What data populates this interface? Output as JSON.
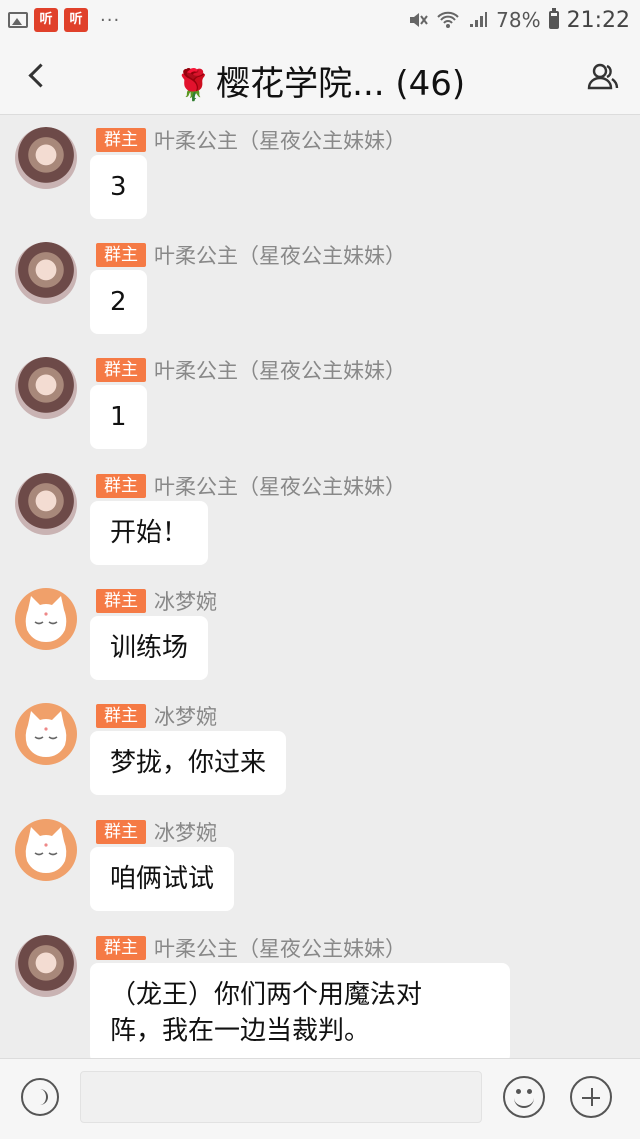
{
  "status_bar": {
    "app_badge_1": "听",
    "app_badge_2": "听",
    "dots": "···",
    "battery": "78%",
    "time": "21:22",
    "icons": [
      "image-icon",
      "mute-icon",
      "wifi-icon",
      "signal-icon",
      "battery-icon"
    ]
  },
  "header": {
    "emoji": "🌹",
    "title": "樱花学院... (46)",
    "icons": [
      "back-icon",
      "members-icon"
    ]
  },
  "messages": [
    {
      "role": "群主",
      "sender": "叶柔公主（星夜公主妹妹）",
      "avatar": "girl-avatar",
      "text": "3"
    },
    {
      "role": "群主",
      "sender": "叶柔公主（星夜公主妹妹）",
      "avatar": "girl-avatar",
      "text": "2"
    },
    {
      "role": "群主",
      "sender": "叶柔公主（星夜公主妹妹）",
      "avatar": "girl-avatar",
      "text": "1"
    },
    {
      "role": "群主",
      "sender": "叶柔公主（星夜公主妹妹）",
      "avatar": "girl-avatar",
      "text": "开始！"
    },
    {
      "role": "群主",
      "sender": "冰梦婉",
      "avatar": "cat-avatar",
      "text": "训练场"
    },
    {
      "role": "群主",
      "sender": "冰梦婉",
      "avatar": "cat-avatar",
      "text": "梦拢，你过来"
    },
    {
      "role": "群主",
      "sender": "冰梦婉",
      "avatar": "cat-avatar",
      "text": "咱俩试试"
    },
    {
      "role": "群主",
      "sender": "叶柔公主（星夜公主妹妹）",
      "avatar": "girl-avatar",
      "text_lines": [
        "（龙王）你们两个用魔法对",
        "阵，我在一边当裁判。"
      ]
    }
  ],
  "input_bar": {
    "icons": [
      "voice-icon",
      "emoji-icon",
      "plus-icon"
    ]
  },
  "colors": {
    "badge": "#f57a45",
    "background": "#ededed",
    "bubble": "#ffffff"
  }
}
